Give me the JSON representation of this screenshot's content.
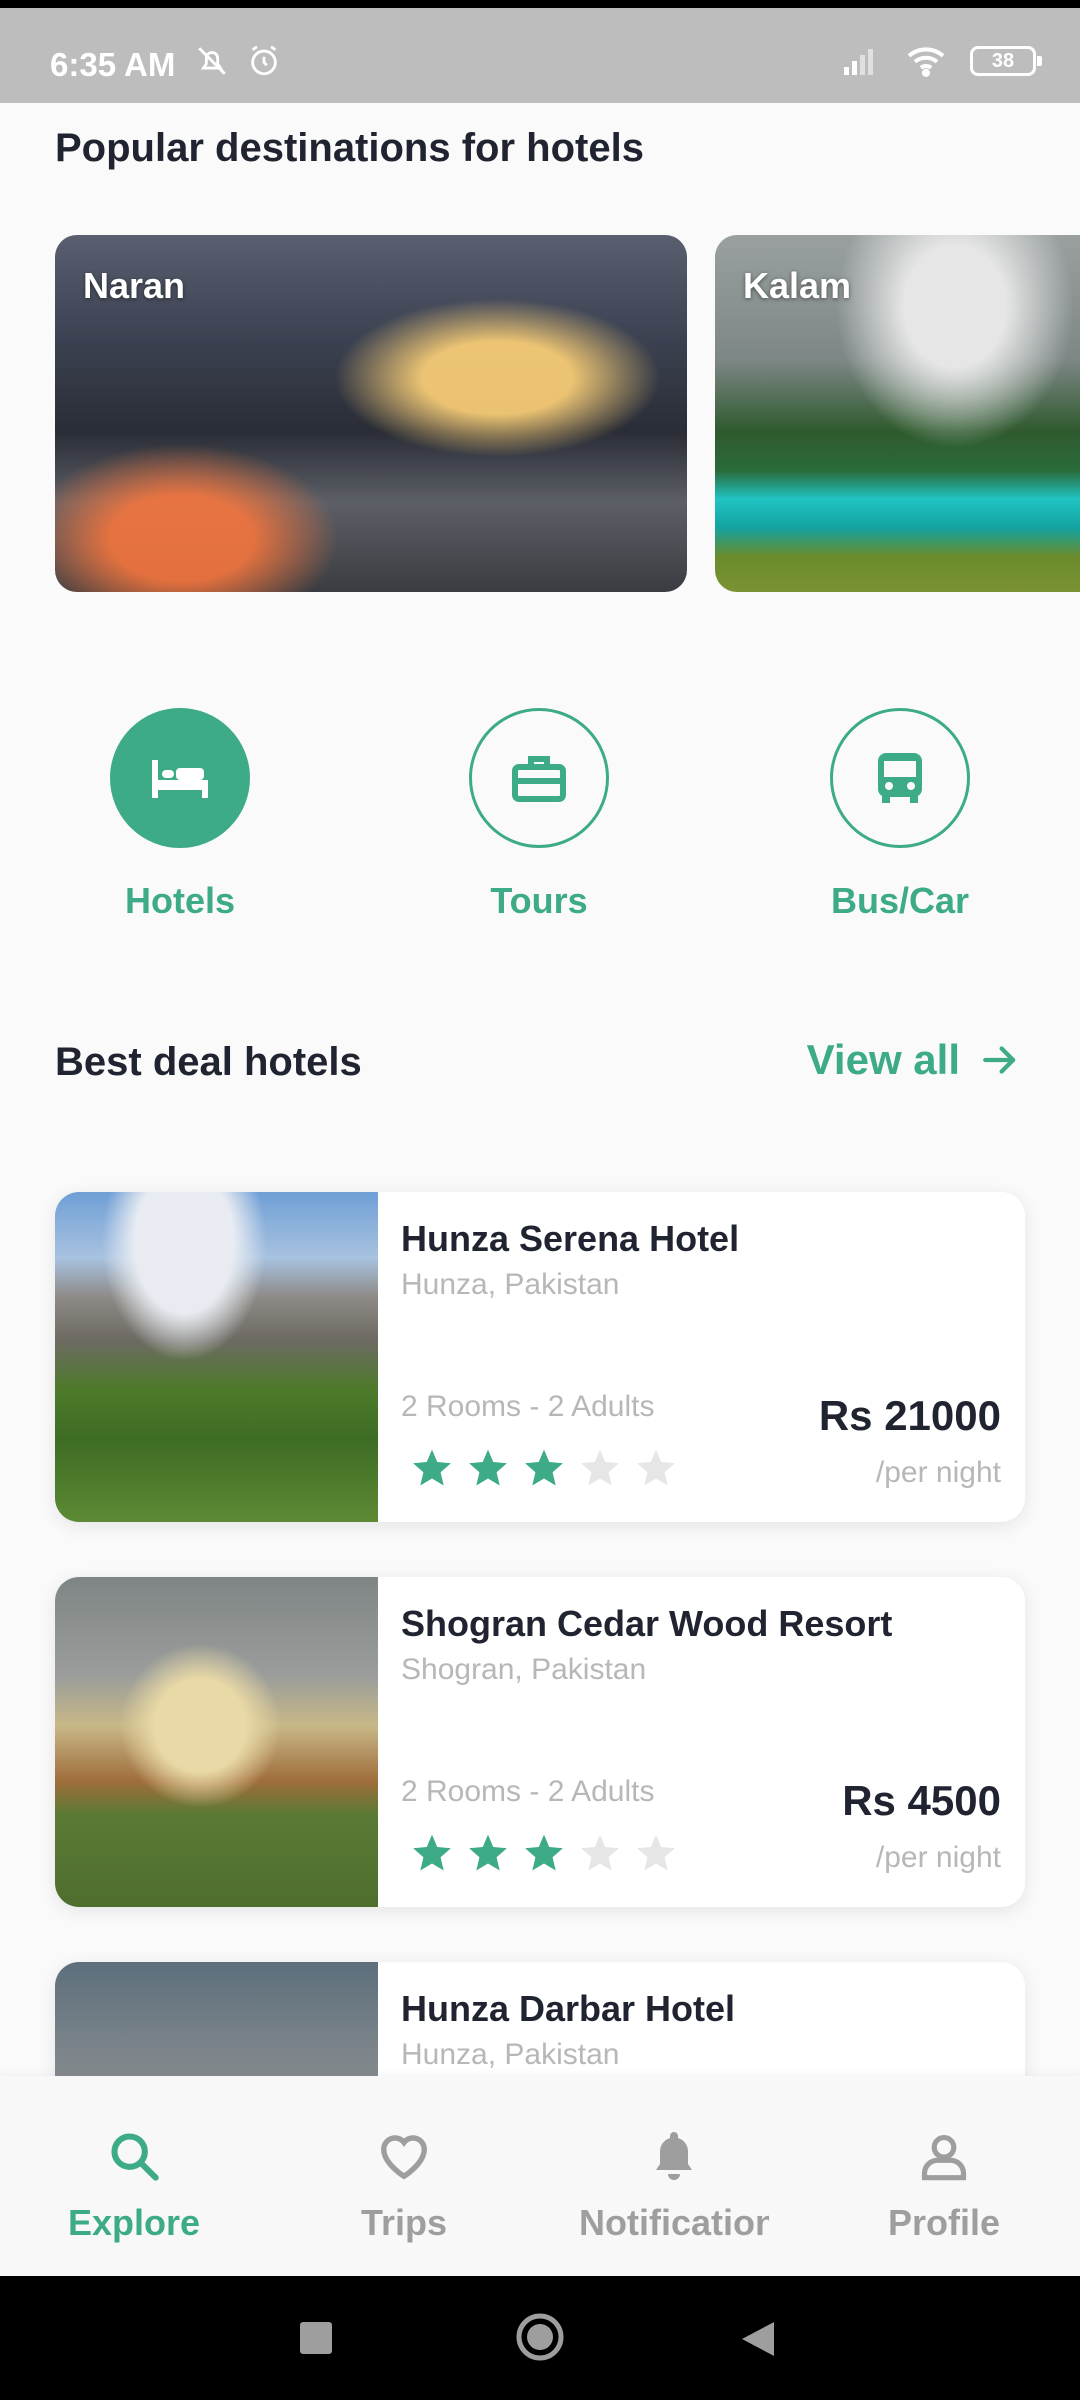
{
  "status_bar": {
    "time": "6:35 AM",
    "battery": "38",
    "icons_left": [
      "bell-off-icon",
      "alarm-icon"
    ],
    "icons_right": [
      "signal-icon",
      "wifi-icon",
      "battery-icon"
    ]
  },
  "popular": {
    "title": "Popular destinations for hotels",
    "destinations": [
      {
        "name": "Naran"
      },
      {
        "name": "Kalam"
      }
    ]
  },
  "categories": [
    {
      "label": "Hotels",
      "icon": "bed-icon",
      "active": true
    },
    {
      "label": "Tours",
      "icon": "briefcase-icon",
      "active": false
    },
    {
      "label": "Bus/Car",
      "icon": "bus-icon",
      "active": false
    }
  ],
  "best_deals": {
    "title": "Best deal hotels",
    "view_all": "View all",
    "hotels": [
      {
        "name": "Hunza Serena Hotel",
        "location": "Hunza, Pakistan",
        "rooms": "2 Rooms - 2 Adults",
        "price": "Rs 21000",
        "per_night": "/per night",
        "rating": 3,
        "max_rating": 5
      },
      {
        "name": "Shogran Cedar Wood Resort",
        "location": "Shogran, Pakistan",
        "rooms": "2 Rooms - 2 Adults",
        "price": "Rs 4500",
        "per_night": "/per night",
        "rating": 3,
        "max_rating": 5
      },
      {
        "name": "Hunza Darbar Hotel",
        "location": "Hunza, Pakistan"
      }
    ]
  },
  "bottom_nav": [
    {
      "label": "Explore",
      "icon": "search-icon",
      "active": true
    },
    {
      "label": "Trips",
      "icon": "heart-icon",
      "active": false
    },
    {
      "label": "Notifications",
      "icon": "bell-icon",
      "active": false
    },
    {
      "label": "Profile",
      "icon": "person-icon",
      "active": false
    }
  ],
  "colors": {
    "accent": "#3daa88",
    "text": "#1f2430",
    "muted": "#b7b7b7",
    "star_empty": "#e6e6e6"
  }
}
